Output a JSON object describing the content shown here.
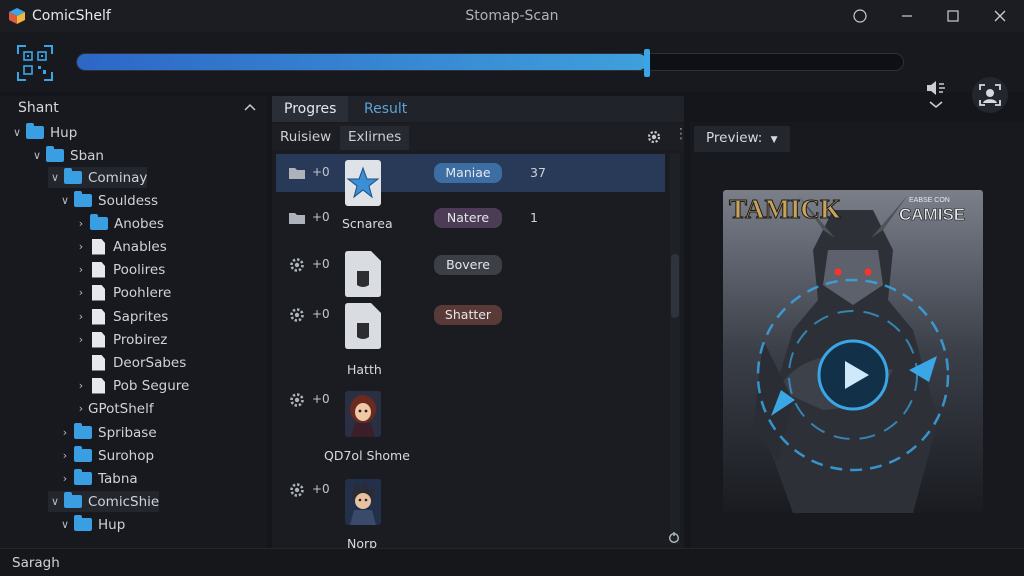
{
  "app": {
    "name": "ComicShelf",
    "window_title": "Stomap-Scan"
  },
  "colors": {
    "accent": "#3aa6e6",
    "progress_start": "#2d67c6",
    "selected_row": "#283a57"
  },
  "toolbar": {
    "scan_icon": "qr-scan-icon",
    "progress": 0.69
  },
  "sidebar": {
    "title": "Shant",
    "items": [
      {
        "label": "Hup",
        "type": "folder",
        "caret": "v"
      },
      {
        "label": "Sban",
        "type": "folder",
        "caret": "v"
      },
      {
        "label": "Cominay",
        "type": "folder",
        "caret": "v"
      },
      {
        "label": "Souldess",
        "type": "folder",
        "caret": "v"
      },
      {
        "label": "Anobes",
        "type": "folder",
        "caret": ">"
      },
      {
        "label": "Anables",
        "type": "file",
        "caret": ">"
      },
      {
        "label": "Poolires",
        "type": "file",
        "caret": ">"
      },
      {
        "label": "Poohlere",
        "type": "file",
        "caret": ">"
      },
      {
        "label": "Saprites",
        "type": "file",
        "caret": ">"
      },
      {
        "label": "Probirez",
        "type": "file",
        "caret": ">"
      },
      {
        "label": "DeorSabes",
        "type": "file",
        "caret": ""
      },
      {
        "label": "Pob Segure",
        "type": "file",
        "caret": ">"
      },
      {
        "label": "GPotShelf",
        "type": "none",
        "caret": ">"
      },
      {
        "label": "Spribase",
        "type": "folder",
        "caret": ">"
      },
      {
        "label": "Surohop",
        "type": "folder",
        "caret": ">"
      },
      {
        "label": "Tabna",
        "type": "folder",
        "caret": ">"
      },
      {
        "label": "ComicShie",
        "type": "folder",
        "caret": "v"
      },
      {
        "label": "Hup",
        "type": "folder",
        "caret": "v"
      }
    ]
  },
  "center": {
    "tabs": [
      {
        "label": "Progres"
      },
      {
        "label": "Result"
      }
    ],
    "subtabs": [
      {
        "label": "Ruisiew"
      },
      {
        "label": "Exlirnes"
      }
    ],
    "rows": [
      {
        "plus": "+0",
        "thumb": "star",
        "label": "",
        "pill": "Maniae",
        "count": "37"
      },
      {
        "plus": "+0",
        "thumb": "",
        "label": "Scnarea",
        "pill": "Natere",
        "count": "1"
      },
      {
        "plus": "+0",
        "thumb": "blank",
        "label": "",
        "pill": "Bovere",
        "count": ""
      },
      {
        "plus": "+0",
        "thumb": "blank",
        "label": "Hatth",
        "pill": "Shatter",
        "count": ""
      },
      {
        "plus": "+0",
        "thumb": "girl",
        "label": "QD7ol Shome",
        "pill": "",
        "count": ""
      },
      {
        "plus": "+0",
        "thumb": "boy",
        "label": "Norp",
        "pill": "",
        "count": ""
      }
    ]
  },
  "preview": {
    "button": "Preview:",
    "cover_title_left": "TAMICK",
    "cover_title_right_small": "EABSE CON",
    "cover_title_right": "CAMISE"
  },
  "status": {
    "text": "Saragh"
  }
}
